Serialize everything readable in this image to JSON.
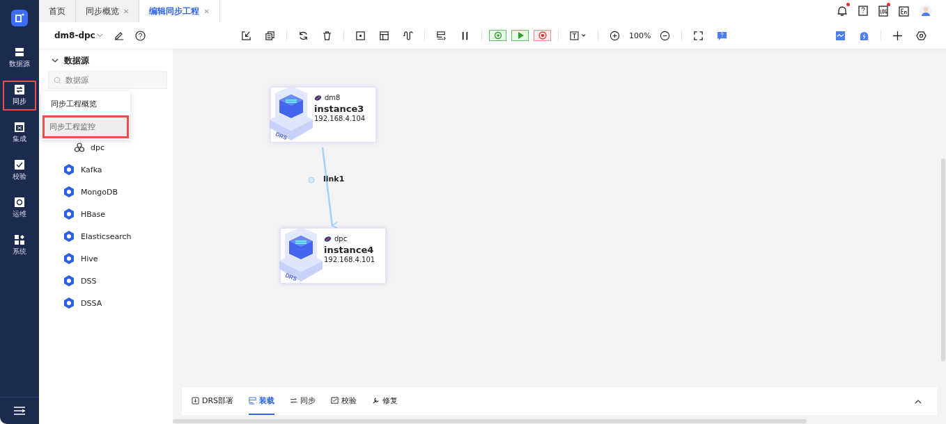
{
  "nav": {
    "items": [
      {
        "kind": "db",
        "label": "数据源",
        "selected": false,
        "highlighted": false
      },
      {
        "kind": "sync",
        "label": "同步",
        "selected": true,
        "highlighted": true
      },
      {
        "kind": "grid",
        "label": "集成",
        "selected": false,
        "highlighted": false
      },
      {
        "kind": "check",
        "label": "校验",
        "selected": false,
        "highlighted": false
      },
      {
        "kind": "gear",
        "label": "运维",
        "selected": false,
        "highlighted": false
      },
      {
        "kind": "apps",
        "label": "系统",
        "selected": false,
        "highlighted": false
      }
    ]
  },
  "tabs": [
    {
      "label": "首页",
      "selected": false
    },
    {
      "label": "同步概览",
      "close": "✕",
      "selected": false
    },
    {
      "label": "编辑同步工程",
      "close": "✕",
      "selected": true
    }
  ],
  "header_icons": [
    {
      "kind": "bell",
      "dot": true
    },
    {
      "kind": "help"
    },
    {
      "kind": "log",
      "dot": true
    },
    {
      "kind": "lang"
    },
    {
      "kind": "avatar"
    }
  ],
  "project": {
    "name": "dm8-dpc"
  },
  "toolbar": {
    "zoom": "100%"
  },
  "tree": {
    "title": "数据源",
    "expanded": true,
    "search": {
      "placeholder": "数据源"
    },
    "items": [
      {
        "children": [
          {
            "label": "dpc"
          }
        ]
      },
      {
        "label": "Kafka"
      },
      {
        "label": "MongoDB"
      },
      {
        "label": "HBase"
      },
      {
        "label": "Elasticsearch"
      },
      {
        "label": "Hive"
      },
      {
        "label": "DSS"
      },
      {
        "label": "DSSA"
      }
    ]
  },
  "popup_menu": {
    "items": [
      {
        "label": "同步工程概览",
        "selected": false,
        "highlighted": false
      },
      {
        "label": "同步工程监控",
        "selected": true,
        "highlighted": true
      }
    ]
  },
  "canvas": {
    "nodes": [
      {
        "badge": "DRS",
        "type": "dm8",
        "name": "instance3",
        "address": "192.168.4.104"
      },
      {
        "badge": "DRS",
        "type": "dpc",
        "name": "instance4",
        "address": "192.168.4.101"
      }
    ],
    "links": [
      {
        "label": "link1"
      }
    ]
  },
  "bottom_tabs": [
    {
      "kind": "deploy",
      "label": "DRS部署",
      "selected": false
    },
    {
      "kind": "load",
      "label": "装载",
      "selected": true
    },
    {
      "kind": "sync",
      "label": "同步",
      "selected": false
    },
    {
      "kind": "check",
      "label": "校验",
      "selected": false
    },
    {
      "kind": "repair",
      "label": "修复",
      "selected": false
    }
  ]
}
